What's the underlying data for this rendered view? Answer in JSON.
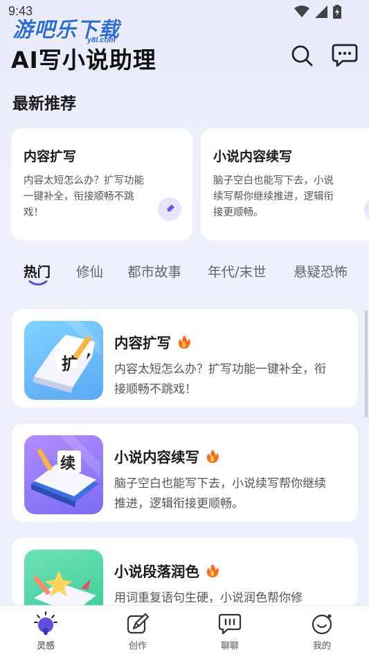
{
  "status": {
    "time": "9:43"
  },
  "watermark": {
    "main": "游吧乐下载",
    "sub": "y8l.com"
  },
  "header": {
    "title": "AI写小说助理",
    "search_icon": "search-icon",
    "chat_icon": "chat-icon"
  },
  "recommend": {
    "title": "最新推荐",
    "cards": [
      {
        "title": "内容扩写",
        "desc": "内容太短怎么办？扩写功能一键补全，衔接顺畅不跳戏！",
        "icon": "pen-icon"
      },
      {
        "title": "小说内容续写",
        "desc": "脑子空白也能写下去，小说续写帮你继续推进，逻辑衔接更顺畅。",
        "icon": "pen-icon"
      }
    ]
  },
  "tabs": [
    {
      "label": "热门",
      "active": true
    },
    {
      "label": "修仙",
      "active": false
    },
    {
      "label": "都市故事",
      "active": false
    },
    {
      "label": "年代/末世",
      "active": false
    },
    {
      "label": "悬疑恐怖",
      "active": false
    }
  ],
  "features": [
    {
      "title": "内容扩写",
      "desc": "内容太短怎么办？扩写功能一键补全，衔接顺畅不跳戏！",
      "badge": "扩",
      "icon": "fire-icon"
    },
    {
      "title": "小说内容续写",
      "desc": "脑子空白也能写下去，小说续写帮你继续推进，逻辑衔接更顺畅。",
      "badge": "续",
      "icon": "fire-icon"
    },
    {
      "title": "小说段落润色",
      "desc": "用词重复语句生硬，小说润色帮你修",
      "icon": "fire-icon"
    }
  ],
  "nav": [
    {
      "label": "灵感",
      "icon": "lightbulb-icon",
      "active": true
    },
    {
      "label": "创作",
      "icon": "edit-icon",
      "active": false
    },
    {
      "label": "聊聊",
      "icon": "chat-icon",
      "active": false
    },
    {
      "label": "我的",
      "icon": "profile-icon",
      "active": false
    }
  ],
  "colors": {
    "accent": "#6b57e8",
    "fire": "#ff6a1a",
    "background": "#eceefb"
  }
}
